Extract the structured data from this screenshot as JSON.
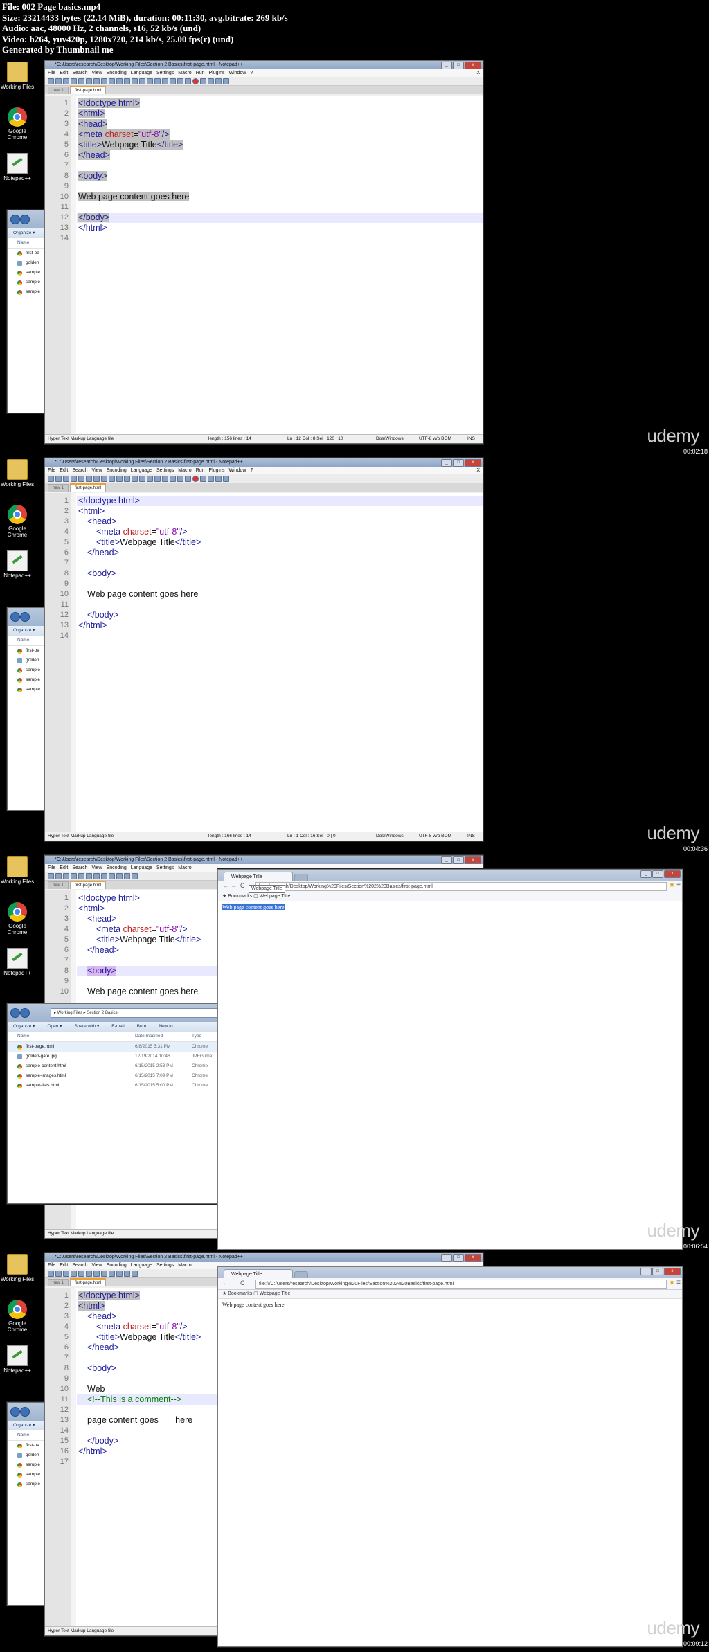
{
  "header": {
    "lines": [
      "File: 002 Page basics.mp4",
      "Size: 23214433 bytes (22.14 MiB), duration: 00:11:30, avg.bitrate: 269 kb/s",
      "Audio: aac, 48000 Hz, 2 channels, s16, 52 kb/s (und)",
      "Video: h264, yuv420p, 1280x720, 214 kb/s, 25.00 fps(r) (und)",
      "Generated by Thumbnail me"
    ]
  },
  "desktop": {
    "icons": [
      {
        "label1": "Working Files",
        "label2": ""
      },
      {
        "label1": "Google",
        "label2": "Chrome"
      },
      {
        "label1": "Notepad++",
        "label2": ""
      }
    ]
  },
  "watermark": "udemy",
  "notepad": {
    "title": "*C:\\Users\\research\\Desktop\\Working Files\\Section 2 Basics\\first-page.html - Notepad++",
    "menu": [
      "File",
      "Edit",
      "Search",
      "View",
      "Encoding",
      "Language",
      "Settings",
      "Macro",
      "Run",
      "Plugins",
      "Window",
      "?"
    ],
    "tab_inactive": "new 1",
    "tab_active": "first-page.html",
    "status_lang": "Hyper Text Markup Language file",
    "close_x": "X"
  },
  "frames": [
    {
      "timestamp": "00:02:18",
      "status_length": "length : 156    lines : 14",
      "status_pos": "Ln : 12    Col : 8    Sel : 120 | 10",
      "status_eol": "Dos\\Windows",
      "status_enc": "UTF-8 w/o BOM",
      "status_ins": "INS"
    },
    {
      "timestamp": "00:04:36",
      "status_length": "length : 166    lines : 14",
      "status_pos": "Ln : 1    Col : 16    Sel : 0 | 0",
      "status_eol": "Dos\\Windows",
      "status_enc": "UTF-8 w/o BOM",
      "status_ins": "INS"
    },
    {
      "timestamp": "00:06:54"
    },
    {
      "timestamp": "00:09:12"
    }
  ],
  "code": {
    "doctype": "<!doctype html>",
    "html_open": "<html>",
    "head_open": "<head>",
    "meta_open": "<meta ",
    "meta_attr": "charset",
    "meta_eq": "=",
    "meta_val": "\"utf-8\"",
    "meta_close": "/>",
    "title_open": "<title>",
    "title_text": "Webpage Title",
    "title_close": "</title>",
    "head_close": "</head>",
    "body_open": "<body>",
    "content": "Web page content goes here",
    "content_web": "Web",
    "comment": "<!--This is a comment-->",
    "content_rest": "page content goes       here",
    "body_close": "</body>",
    "html_close": "</html>"
  },
  "explorer": {
    "breadcrumb": "▸ Working Files ▸ Section 2 Basics",
    "commands": [
      "Organize ▾",
      "Open ▾",
      "Share with ▾",
      "E-mail",
      "Burn",
      "New fo"
    ],
    "col_name": "Name",
    "col_date": "Date modified",
    "col_type": "Type",
    "files": [
      {
        "name": "first-page.html",
        "date": "6/8/2015 5:31 PM",
        "type": "Chrome"
      },
      {
        "name": "golden-gate.jpg",
        "date": "12/19/2014 10:46 ...",
        "type": "JPEG ima"
      },
      {
        "name": "sample-content.html",
        "date": "6/15/2015 2:53 PM",
        "type": "Chrome"
      },
      {
        "name": "sample-images.html",
        "date": "6/15/2015 7:09 PM",
        "type": "Chrome"
      },
      {
        "name": "sample-lists.html",
        "date": "6/15/2015 5:00 PM",
        "type": "Chrome"
      }
    ],
    "short_names": [
      "first-pa",
      "golden",
      "sample",
      "sample",
      "sample"
    ]
  },
  "chrome": {
    "tab_title": "Webpage Title",
    "tooltip": "Webpage Title",
    "url_partial": "hers/research/Desktop/Working%20Files/Section%202%20Basics/first-page.html",
    "url_full": "file:///C:/Users/research/Desktop/Working%20Files/Section%202%20Basics/first-page.html",
    "bookmarks": "★ Bookmarks   ▢ Webpage Title",
    "page_text": "Web page content goes here"
  }
}
